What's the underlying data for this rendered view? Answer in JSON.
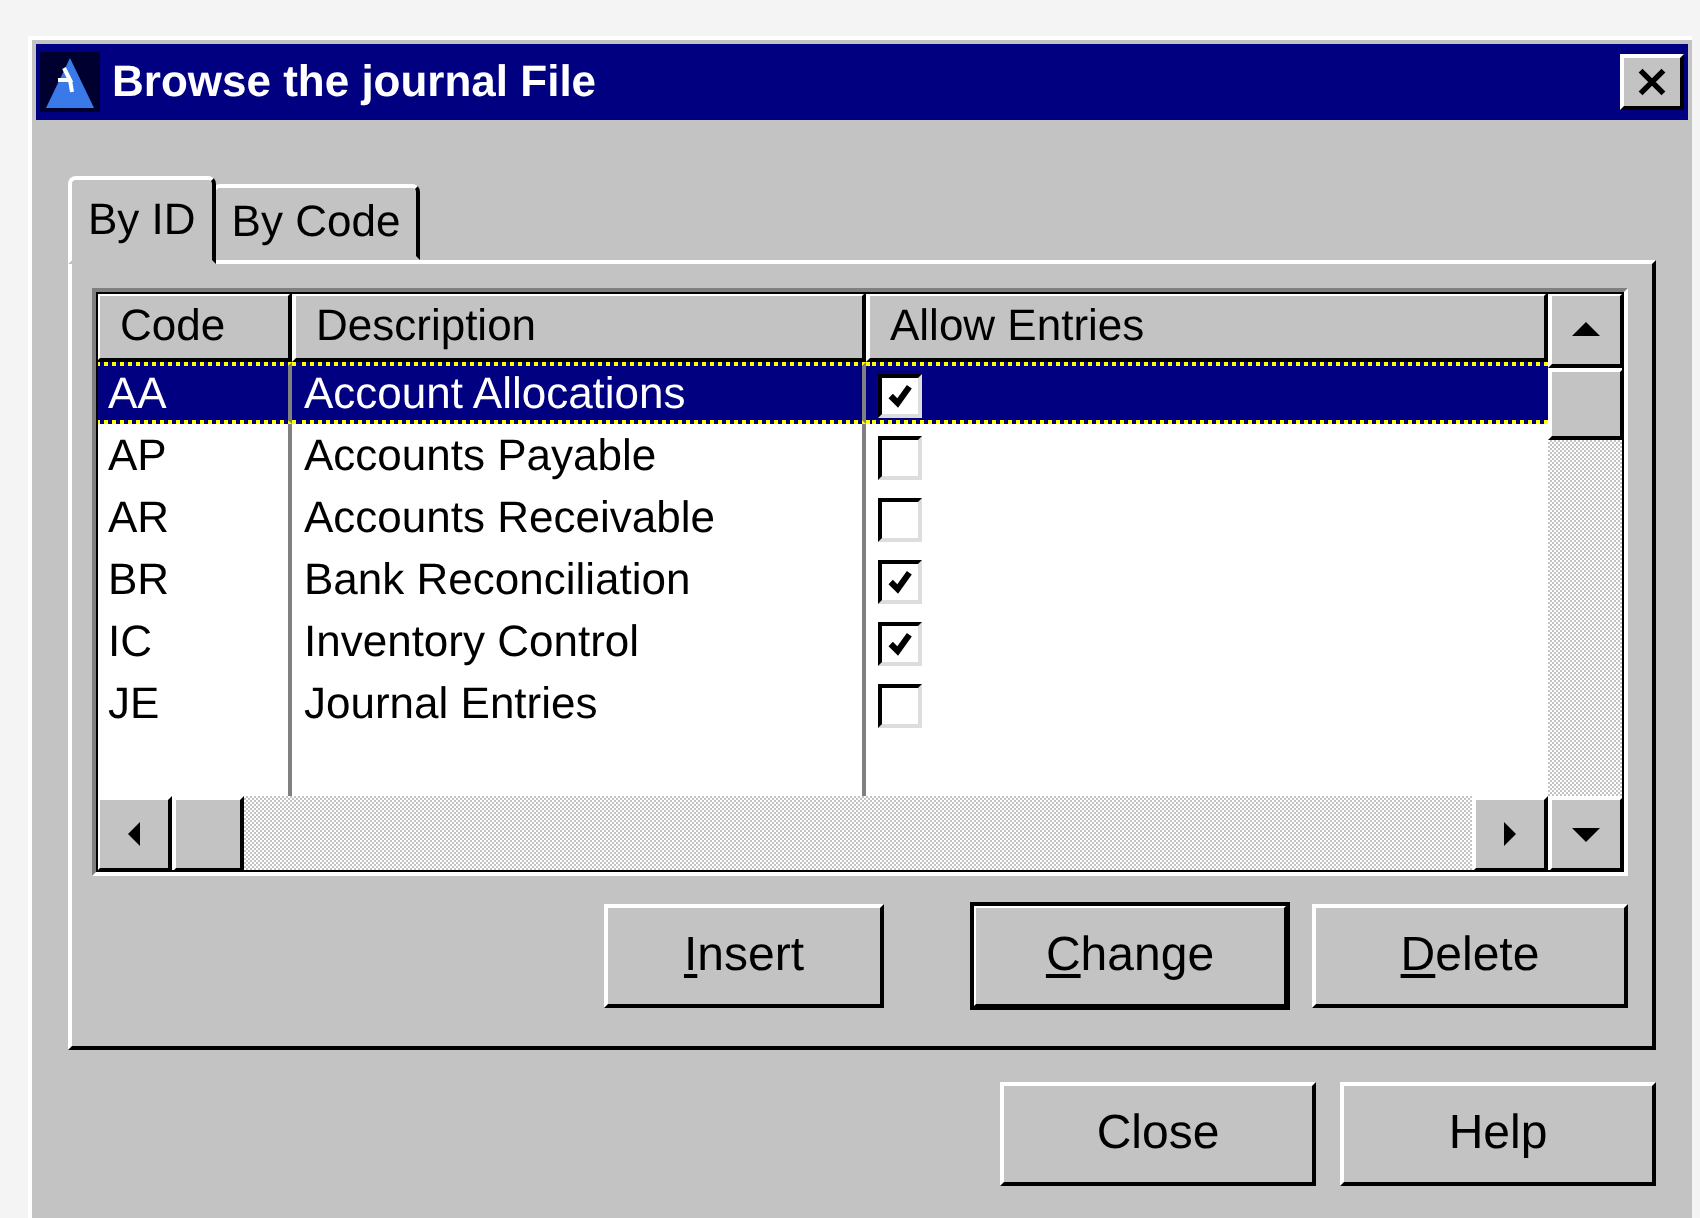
{
  "window": {
    "title": "Browse the journal File"
  },
  "tabs": [
    {
      "label": "By ID",
      "selected": true
    },
    {
      "label": "By Code",
      "selected": false
    }
  ],
  "table": {
    "columns": [
      "Code",
      "Description",
      "Allow Entries"
    ],
    "rows": [
      {
        "code": "AA",
        "description": "Account Allocations",
        "allow_entries": true,
        "selected": true
      },
      {
        "code": "AP",
        "description": "Accounts Payable",
        "allow_entries": false,
        "selected": false
      },
      {
        "code": "AR",
        "description": "Accounts Receivable",
        "allow_entries": false,
        "selected": false
      },
      {
        "code": "BR",
        "description": "Bank Reconciliation",
        "allow_entries": true,
        "selected": false
      },
      {
        "code": "IC",
        "description": "Inventory Control",
        "allow_entries": true,
        "selected": false
      },
      {
        "code": "JE",
        "description": "Journal Entries",
        "allow_entries": false,
        "selected": false
      }
    ]
  },
  "panel_buttons": [
    {
      "label": "Insert",
      "underline_first": true,
      "default": false
    },
    {
      "label": "Change",
      "underline_first": true,
      "default": true
    },
    {
      "label": "Delete",
      "underline_first": true,
      "default": false
    }
  ],
  "dialog_buttons": [
    {
      "label": "Close",
      "underline_first": false,
      "default": false
    },
    {
      "label": "Help",
      "underline_first": false,
      "default": false
    }
  ]
}
